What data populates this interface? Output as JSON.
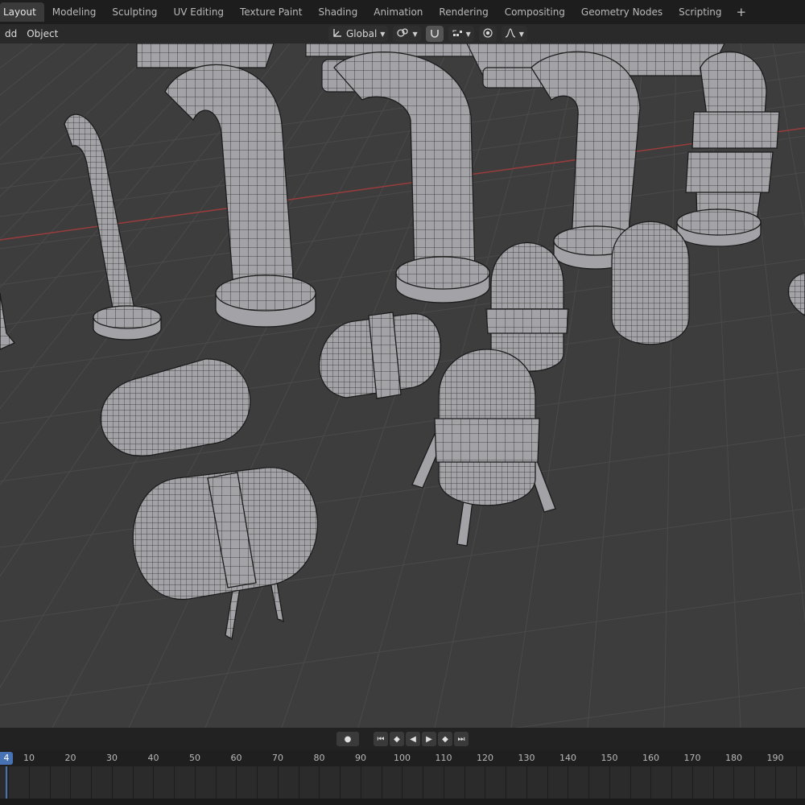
{
  "workspace_tabs": [
    {
      "label": "Layout",
      "active": true
    },
    {
      "label": "Modeling",
      "active": false
    },
    {
      "label": "Sculpting",
      "active": false
    },
    {
      "label": "UV Editing",
      "active": false
    },
    {
      "label": "Texture Paint",
      "active": false
    },
    {
      "label": "Shading",
      "active": false
    },
    {
      "label": "Animation",
      "active": false
    },
    {
      "label": "Rendering",
      "active": false
    },
    {
      "label": "Compositing",
      "active": false
    },
    {
      "label": "Geometry Nodes",
      "active": false
    },
    {
      "label": "Scripting",
      "active": false
    }
  ],
  "add_workspace_label": "+",
  "header": {
    "menu_add": "dd",
    "menu_object": "Object",
    "transform_orientation": "Global"
  },
  "icons": {
    "orientation": "transform-orientation-icon",
    "pivot": "pivot-point-icon",
    "snap": "snap-icon",
    "snap_target": "snap-increment-icon",
    "proportional": "proportional-editing-icon",
    "falloff": "falloff-curve-icon"
  },
  "colors": {
    "viewport_bg": "#3d3d3d",
    "grid_line": "#4a4a4a",
    "x_axis": "#9b3c3c",
    "mesh_fill": "#a3a3a7",
    "wire": "#1c1c1c",
    "accent": "#4772b3"
  },
  "timeline": {
    "current_frame": "4",
    "frame_labels": [
      "10",
      "20",
      "30",
      "40",
      "50",
      "60",
      "70",
      "80",
      "90",
      "100",
      "110",
      "120",
      "130",
      "140",
      "150",
      "160",
      "170",
      "180",
      "190"
    ]
  }
}
